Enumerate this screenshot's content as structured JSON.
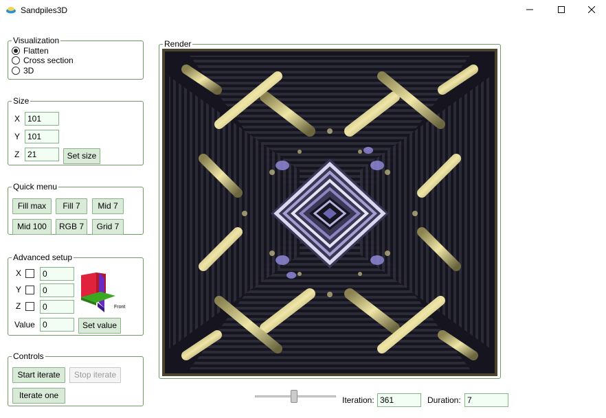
{
  "window": {
    "title": "Sandpiles3D",
    "minimize_icon": "minimize-icon",
    "maximize_icon": "maximize-icon",
    "close_icon": "close-icon"
  },
  "visualization": {
    "legend": "Visualization",
    "options": [
      {
        "label": "Flatten",
        "checked": true
      },
      {
        "label": "Cross section",
        "checked": false
      },
      {
        "label": "3D",
        "checked": false
      }
    ]
  },
  "size": {
    "legend": "Size",
    "x_label": "X",
    "x_value": "101",
    "y_label": "Y",
    "y_value": "101",
    "z_label": "Z",
    "z_value": "21",
    "set_size": "Set size"
  },
  "quick_menu": {
    "legend": "Quick menu",
    "buttons": [
      "Fill max",
      "Fill 7",
      "Mid 7",
      "Mid 100",
      "RGB 7",
      "Grid 7"
    ]
  },
  "advanced": {
    "legend": "Advanced setup",
    "x_label": "X",
    "x_value": "0",
    "y_label": "Y",
    "y_value": "0",
    "z_label": "Z",
    "z_value": "0",
    "value_label": "Value",
    "value_value": "0",
    "set_value": "Set value",
    "axes_front_label": "Front"
  },
  "controls": {
    "legend": "Controls",
    "start": "Start iterate",
    "stop": "Stop iterate",
    "iterate_one": "Iterate one"
  },
  "render": {
    "legend": "Render"
  },
  "status": {
    "speed_level": 0.47,
    "iteration_label": "Iteration:",
    "iteration_value": "361",
    "duration_label": "Duration:",
    "duration_value": "7"
  },
  "colors": {
    "group_border": "#6f9a63",
    "button_bg": "#d9ead9",
    "render_bg": "#15141f",
    "sand_gold": "#d8cf8a",
    "sand_violet": "#9b93d8"
  }
}
